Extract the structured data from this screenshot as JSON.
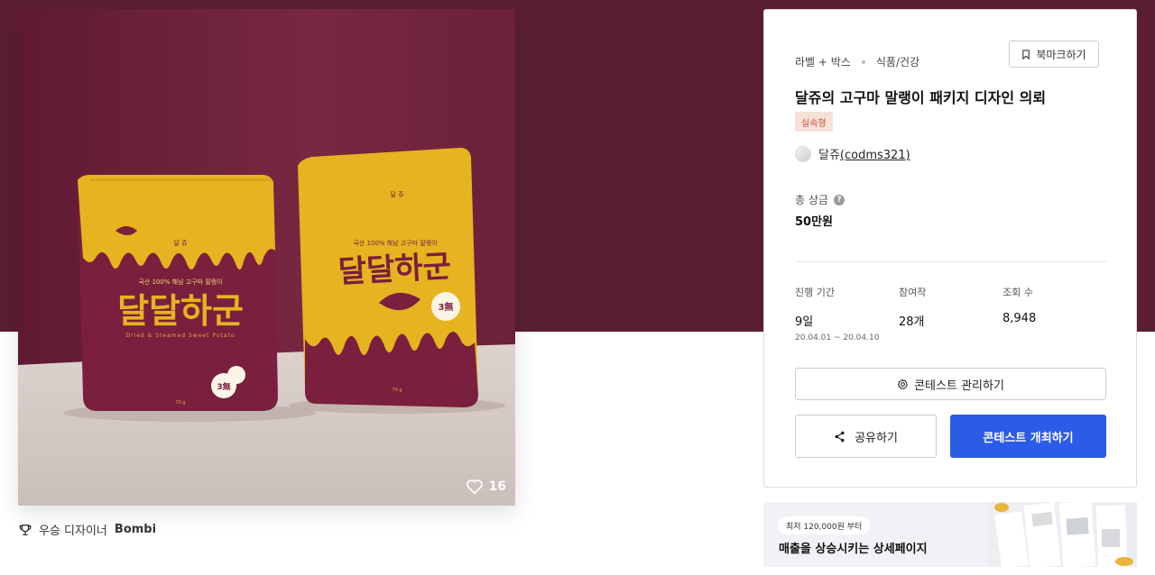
{
  "gallery": {
    "likes": "16",
    "pouch_front": {
      "brand_text": "달달하군",
      "tagline": "국산 100% 해남 고구마 말랭이",
      "english": "Dried & Steamed Sweet Potato",
      "badge": "3無",
      "weight": "70 g"
    },
    "pouch_side": {
      "brand_text": "달달하군",
      "tagline": "국산 100% 해남 고구마 말랭이",
      "badge": "3無",
      "weight": "70 g"
    }
  },
  "winner": {
    "label": "우승 디자이너",
    "name": "Bombi"
  },
  "contest": {
    "category_main": "라벨 + 박스",
    "category_sub": "식품/건강",
    "bookmark_label": "북마크하기",
    "title": "달쥬의 고구마 말랭이 패키지 디자인 의뢰",
    "badge": "실속형",
    "host_name": "달쥬",
    "host_id": "(codms321)",
    "prize_label": "총 상금",
    "prize_help": "?",
    "prize_value": "50만원",
    "stats": [
      {
        "label": "진행 기간",
        "value": "9일",
        "sub": "20.04.01 ~ 20.04.10"
      },
      {
        "label": "참여작",
        "value": "28개"
      },
      {
        "label": "조회 수",
        "value": "8,948"
      }
    ],
    "manage_label": "콘테스트 관리하기",
    "share_label": "공유하기",
    "host_button_label": "콘테스트 개최하기"
  },
  "ad": {
    "price": "최저 120,000원 부터",
    "title": "매출을 상승시키는 상세페이지"
  },
  "colors": {
    "hero_bg": "#5a1e32",
    "pouch_mustard": "#e6b321",
    "pouch_maroon": "#7a1f3d",
    "primary_button": "#2b5be7",
    "badge_bg": "#f6e1d8",
    "badge_text": "#c4573a"
  },
  "icons": [
    "heart-icon",
    "trophy-icon",
    "bookmark-icon",
    "gear-icon",
    "share-icon",
    "question-icon"
  ]
}
